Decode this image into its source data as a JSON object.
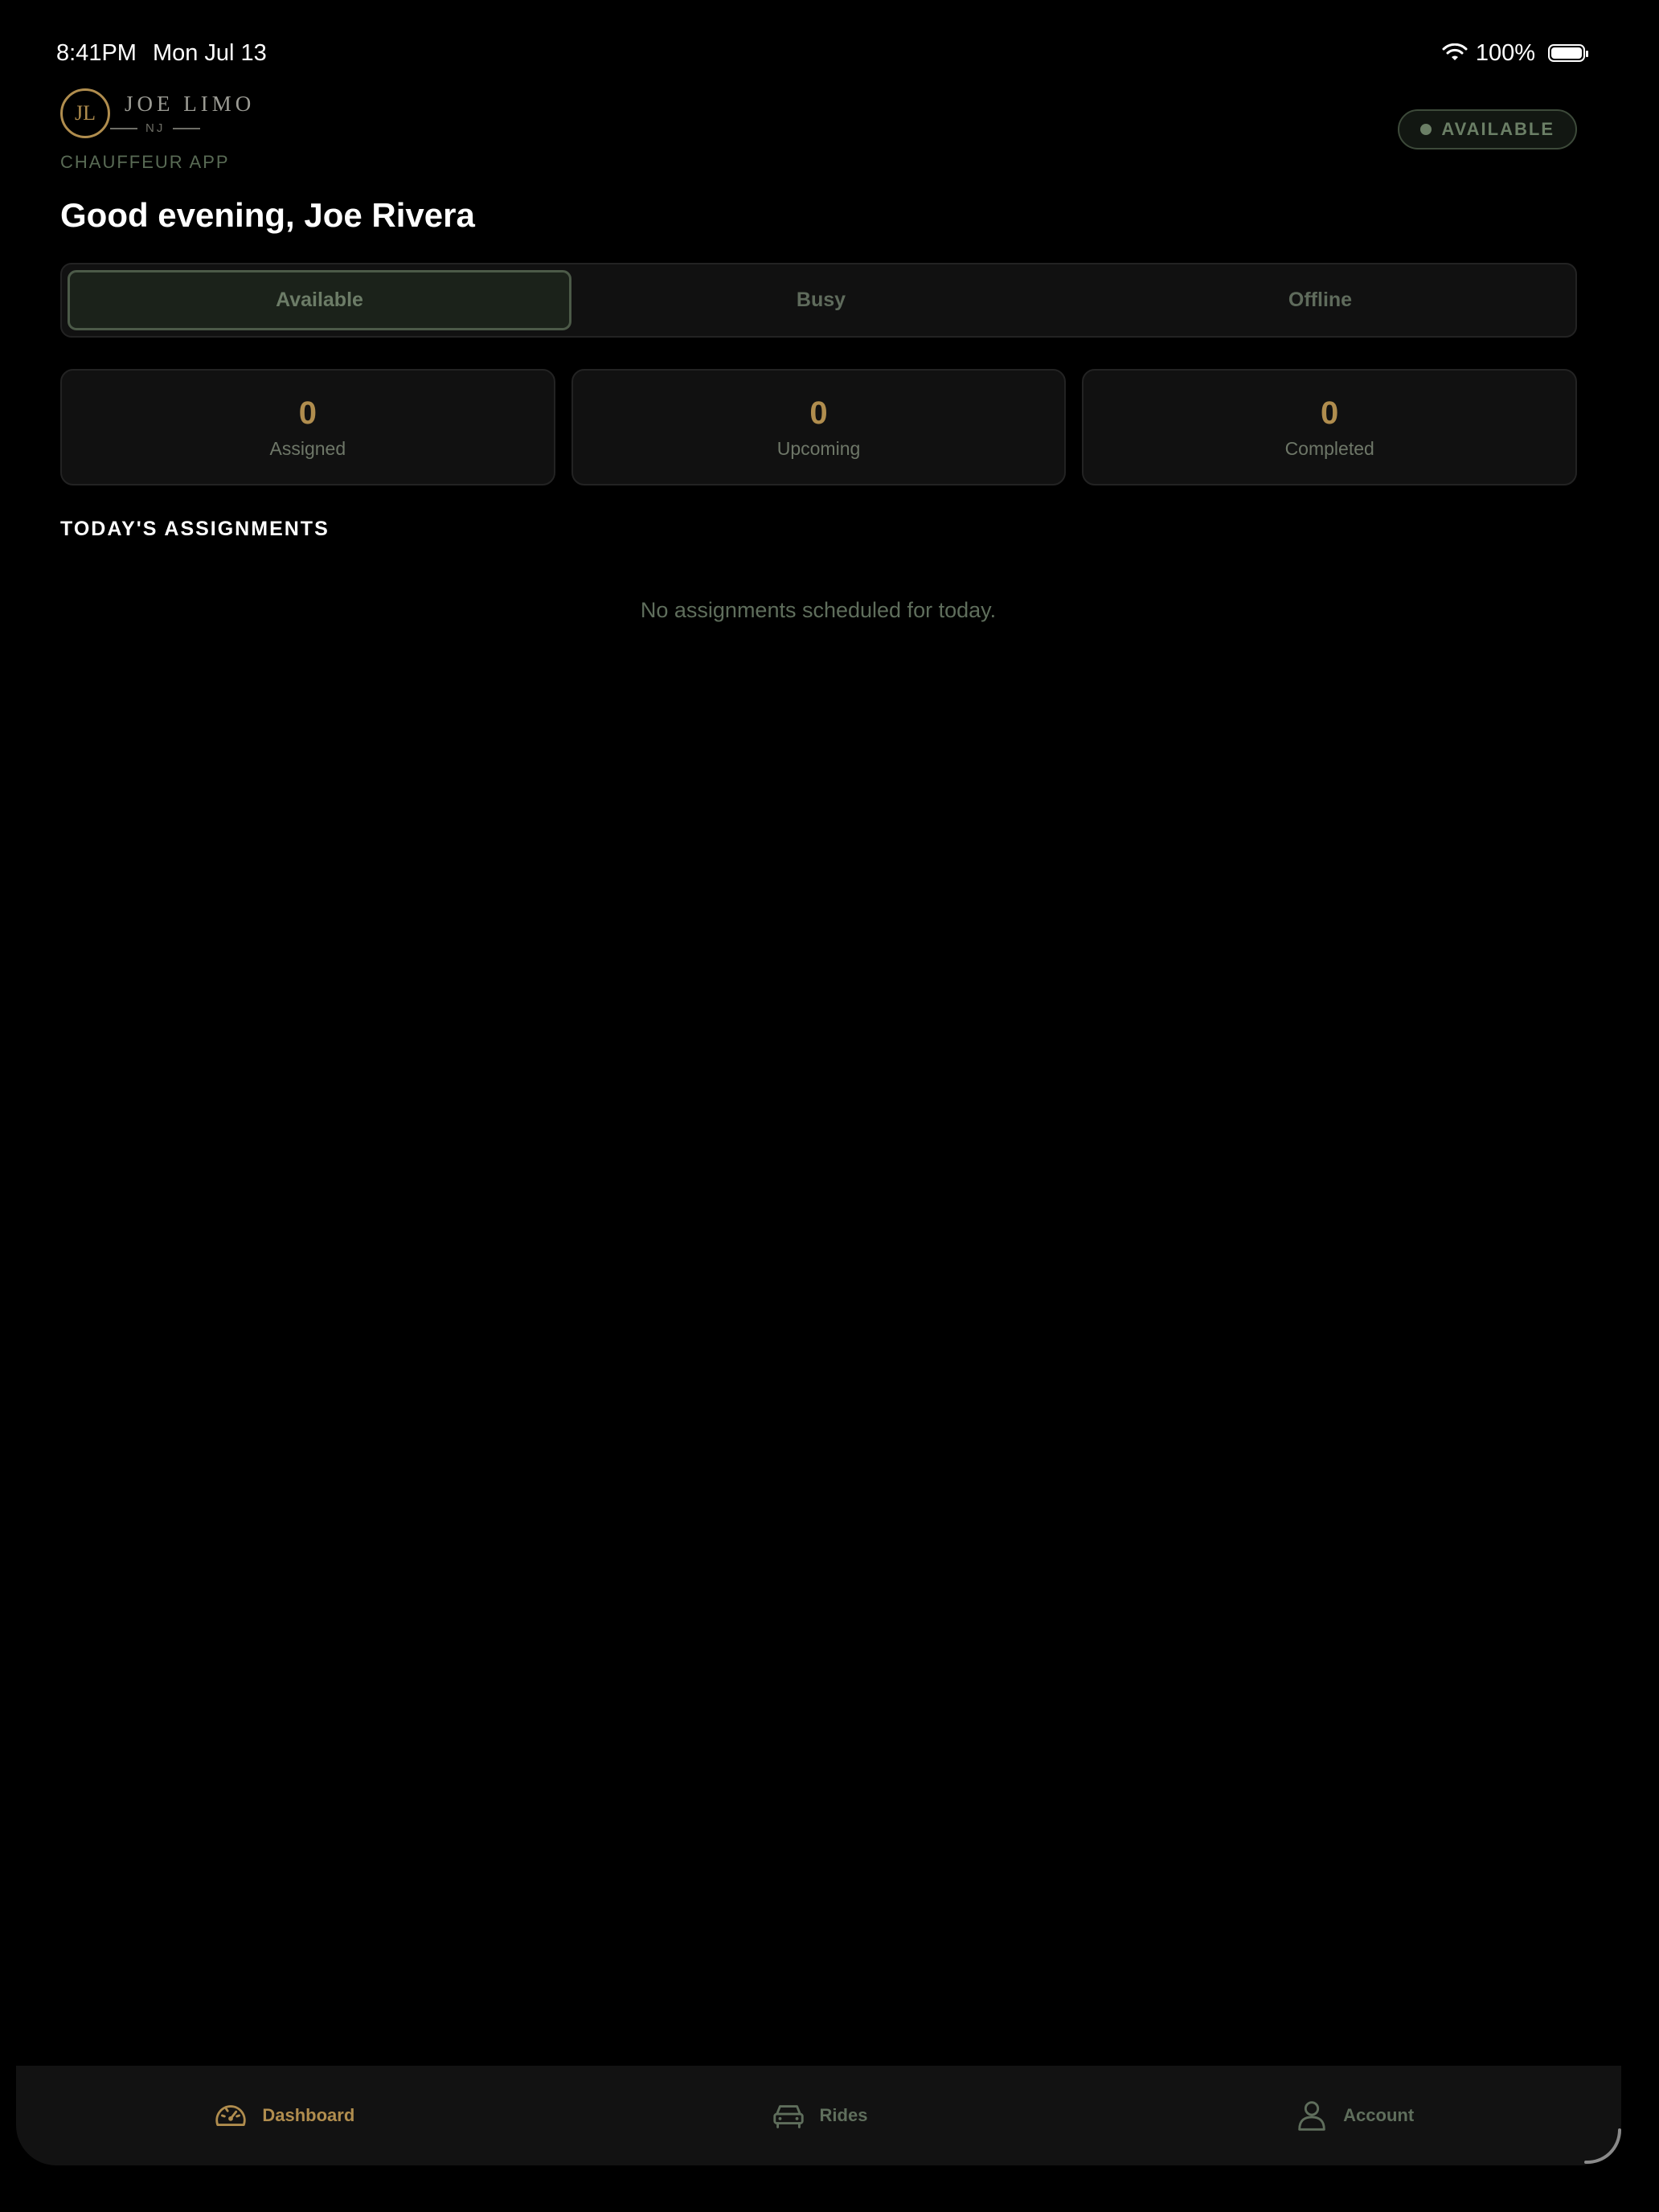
{
  "status_bar": {
    "time": "8:41PM",
    "date": "Mon Jul 13",
    "battery": "100%"
  },
  "header": {
    "logo_initials": "JL",
    "logo_name": "JOE LIMO",
    "logo_region": "NJ",
    "app_subtitle": "CHAUFFEUR APP",
    "status_pill": "AVAILABLE"
  },
  "greeting": "Good evening, Joe Rivera",
  "status_selector": {
    "options": [
      "Available",
      "Busy",
      "Offline"
    ],
    "selected": "Available"
  },
  "stats": [
    {
      "value": "0",
      "label": "Assigned"
    },
    {
      "value": "0",
      "label": "Upcoming"
    },
    {
      "value": "0",
      "label": "Completed"
    }
  ],
  "assignments": {
    "title": "TODAY'S ASSIGNMENTS",
    "empty_message": "No assignments scheduled for today."
  },
  "tab_bar": {
    "tabs": [
      {
        "label": "Dashboard",
        "icon": "speedometer-icon",
        "active": true
      },
      {
        "label": "Rides",
        "icon": "car-icon",
        "active": false
      },
      {
        "label": "Account",
        "icon": "person-icon",
        "active": false
      }
    ]
  },
  "colors": {
    "accent_gold": "#b08d4e",
    "status_green": "#6b7f66",
    "background": "#000000"
  }
}
